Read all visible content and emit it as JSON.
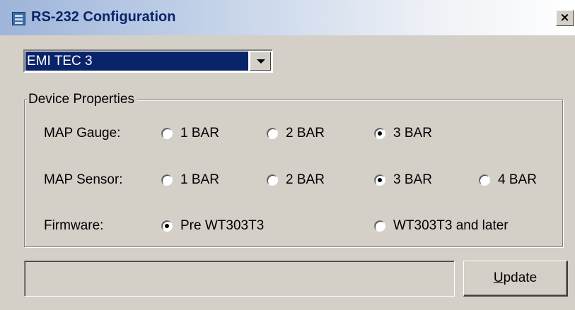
{
  "window": {
    "title": "RS-232 Configuration",
    "close_label": "×",
    "icon": "serial-port-icon"
  },
  "device_select": {
    "selected": "EMI TEC 3"
  },
  "device_properties": {
    "group_label": "Device Properties",
    "map_gauge": {
      "label": "MAP Gauge:",
      "options": [
        "1 BAR",
        "2 BAR",
        "3 BAR"
      ],
      "selected": "3 BAR"
    },
    "map_sensor": {
      "label": "MAP Sensor:",
      "options": [
        "1 BAR",
        "2 BAR",
        "3 BAR",
        "4 BAR"
      ],
      "selected": "3 BAR"
    },
    "firmware": {
      "label": "Firmware:",
      "options": [
        "Pre WT303T3",
        "WT303T3 and later"
      ],
      "selected": "Pre WT303T3"
    }
  },
  "status": {
    "text": ""
  },
  "update_button": {
    "mnemonic": "U",
    "rest": "pdate"
  },
  "colors": {
    "selection": "#0a246a",
    "face": "#d4d0c8",
    "title_text": "#0a246a"
  }
}
